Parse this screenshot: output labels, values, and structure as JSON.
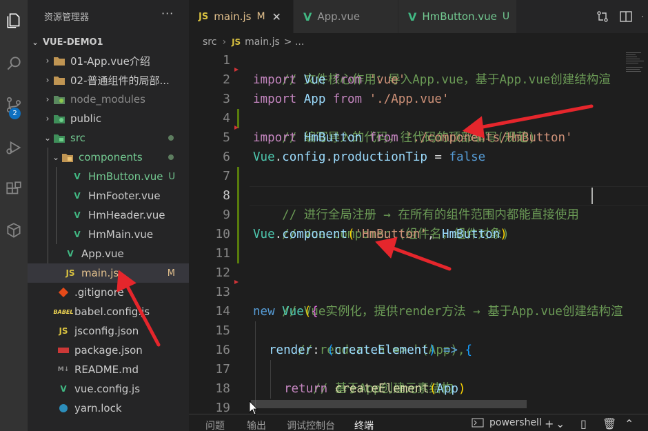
{
  "sidebar": {
    "title": "资源管理器",
    "more": "···",
    "project": "VUE-DEMO1",
    "items": [
      {
        "label": "01-App.vue介绍",
        "kind": "folder",
        "chev": "›"
      },
      {
        "label": "02-普通组件的局部...",
        "kind": "folder",
        "chev": "›"
      },
      {
        "label": "node_modules",
        "kind": "node-folder",
        "chev": "›"
      },
      {
        "label": "public",
        "kind": "public-folder",
        "chev": "›"
      },
      {
        "label": "src",
        "kind": "src-folder",
        "chev": "⌄"
      },
      {
        "label": "components",
        "kind": "components-folder",
        "chev": "⌄"
      },
      {
        "label": "HmButton.vue",
        "kind": "vue",
        "status": "U"
      },
      {
        "label": "HmFooter.vue",
        "kind": "vue"
      },
      {
        "label": "HmHeader.vue",
        "kind": "vue"
      },
      {
        "label": "HmMain.vue",
        "kind": "vue"
      },
      {
        "label": "App.vue",
        "kind": "vue"
      },
      {
        "label": "main.js",
        "kind": "js",
        "status": "M"
      },
      {
        "label": ".gitignore",
        "kind": "git"
      },
      {
        "label": "babel.config.js",
        "kind": "babel"
      },
      {
        "label": "jsconfig.json",
        "kind": "js"
      },
      {
        "label": "package.json",
        "kind": "npm"
      },
      {
        "label": "README.md",
        "kind": "md"
      },
      {
        "label": "vue.config.js",
        "kind": "vue"
      },
      {
        "label": "yarn.lock",
        "kind": "yarn"
      }
    ]
  },
  "activity": {
    "badge": "2"
  },
  "tabs": [
    {
      "icon": "JS",
      "label": "main.js",
      "modified": "M",
      "close": "✕"
    },
    {
      "icon": "V",
      "label": "App.vue"
    },
    {
      "icon": "V",
      "label": "HmButton.vue",
      "modified": "U"
    }
  ],
  "breadcrumb": {
    "folder": "src",
    "sep": "›",
    "icon": "JS",
    "file": "main.js",
    "tail": "> ..."
  },
  "editor": {
    "lines": [
      "1",
      "2",
      "3",
      "4",
      "5",
      "6",
      "7",
      "8",
      "9",
      "10",
      "11",
      "12",
      "13",
      "14",
      "15",
      "16",
      "17",
      "18",
      "19"
    ],
    "code": {
      "l1_com": "// 文件核心作用：导入App.vue，基于App.vue创建结构渲",
      "l2_kw1": "import",
      "l2_var": " Vue ",
      "l2_kw2": "from",
      "l2_str": " 'vue'",
      "l3_kw1": "import",
      "l3_var": " App ",
      "l3_kw2": "from",
      "l3_str": " './App.vue'",
      "l4_com": "// 编写导入的代码，往代码的顶部编写(规范)",
      "l5_kw1": "import",
      "l5_var": " HmButton ",
      "l5_kw2": "from",
      "l5_str": " './components/HmButton'",
      "l6_cls": "Vue",
      "l6_dot1": ".",
      "l6_var1": "config",
      "l6_dot2": ".",
      "l6_var2": "productionTip",
      "l6_eq": " = ",
      "l6_bool": "false",
      "l8_com": "// 进行全局注册 → 在所有的组件范围内都能直接使用",
      "l9_com": "// Vue.component(组件名，组件对象)",
      "l10_cls": "Vue",
      "l10_dot": ".",
      "l10_fn": "component",
      "l10_p1": "(",
      "l10_str": "'HmButton'",
      "l10_comma": ", ",
      "l10_var": "HmButton",
      "l10_p2": ")",
      "l13_com": "// Vue实例化，提供render方法 → 基于App.vue创建结构渲",
      "l14_kw": "new",
      "l14_cls": " Vue",
      "l14_p": "(",
      "l14_b": "{",
      "l15_com": "// render: h => h(App),",
      "l16_fn": "render",
      "l16_colon": ": ",
      "l16_p1": "(",
      "l16_var": "createElement",
      "l16_p2": ")",
      "l16_arrow": " => ",
      "l16_b": "{",
      "l17_com": "// 基于App创建元素结构",
      "l18_kw": "return",
      "l18_fn": " createElement",
      "l18_p1": "(",
      "l18_var": "App",
      "l18_p2": ")",
      "l19_b": "}"
    }
  },
  "panel": {
    "tabs": [
      "问题",
      "输出",
      "调试控制台",
      "终端"
    ],
    "shell": "powershell",
    "plus": "+",
    "chevron": "⌄"
  }
}
